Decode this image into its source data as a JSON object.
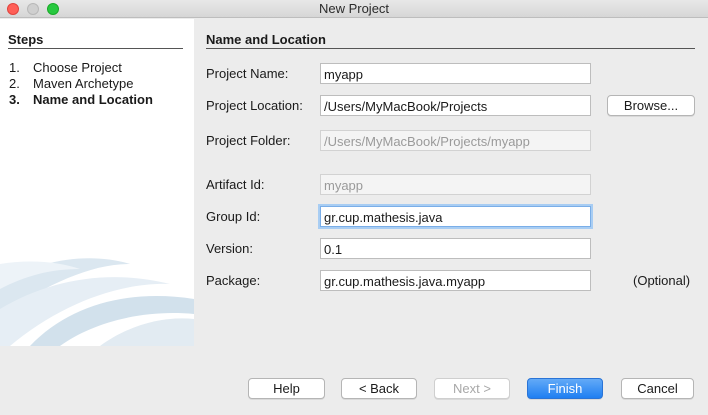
{
  "window": {
    "title": "New Project"
  },
  "steps": {
    "header": "Steps",
    "items": [
      {
        "num": "1.",
        "label": "Choose Project",
        "active": false
      },
      {
        "num": "2.",
        "label": "Maven Archetype",
        "active": false
      },
      {
        "num": "3.",
        "label": "Name and Location",
        "active": true
      }
    ]
  },
  "section": {
    "header": "Name and Location"
  },
  "form": {
    "project_name": {
      "label": "Project Name:",
      "value": "myapp"
    },
    "project_location": {
      "label": "Project Location:",
      "value": "/Users/MyMacBook/Projects"
    },
    "browse_label": "Browse...",
    "project_folder": {
      "label": "Project Folder:",
      "value": "/Users/MyMacBook/Projects/myapp"
    },
    "artifact_id": {
      "label": "Artifact Id:",
      "value": "myapp"
    },
    "group_id": {
      "label": "Group Id:",
      "value": "gr.cup.mathesis.java"
    },
    "version": {
      "label": "Version:",
      "value": "0.1"
    },
    "package": {
      "label": "Package:",
      "value": "gr.cup.mathesis.java.myapp",
      "optional": "(Optional)"
    }
  },
  "buttons": {
    "help": "Help",
    "back": "< Back",
    "next": "Next >",
    "finish": "Finish",
    "cancel": "Cancel"
  },
  "colors": {
    "accent": "#1f7ff2",
    "focus_ring": "#a8cdf3"
  }
}
